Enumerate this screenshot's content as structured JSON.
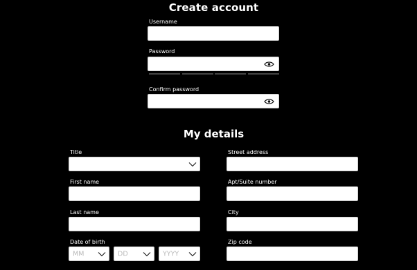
{
  "create_account": {
    "heading": "Create account",
    "username_label": "Username",
    "username_value": "",
    "password_label": "Password",
    "password_value": "",
    "confirm_label": "Confirm password",
    "confirm_value": ""
  },
  "my_details": {
    "heading": "My details",
    "title_label": "Title",
    "title_value": "",
    "first_name_label": "First name",
    "last_name_label": "Last name",
    "dob_label": "Date of birth",
    "dob_month_placeholder": "MM",
    "dob_day_placeholder": "DD",
    "dob_year_placeholder": "YYYY",
    "street_label": "Street address",
    "apt_label": "Apt/Suite number",
    "city_label": "City",
    "zip_label": "Zip code"
  },
  "icons": {
    "password_toggle": "eye-icon",
    "confirm_toggle": "eye-icon",
    "dropdown": "chevron-down-icon"
  }
}
